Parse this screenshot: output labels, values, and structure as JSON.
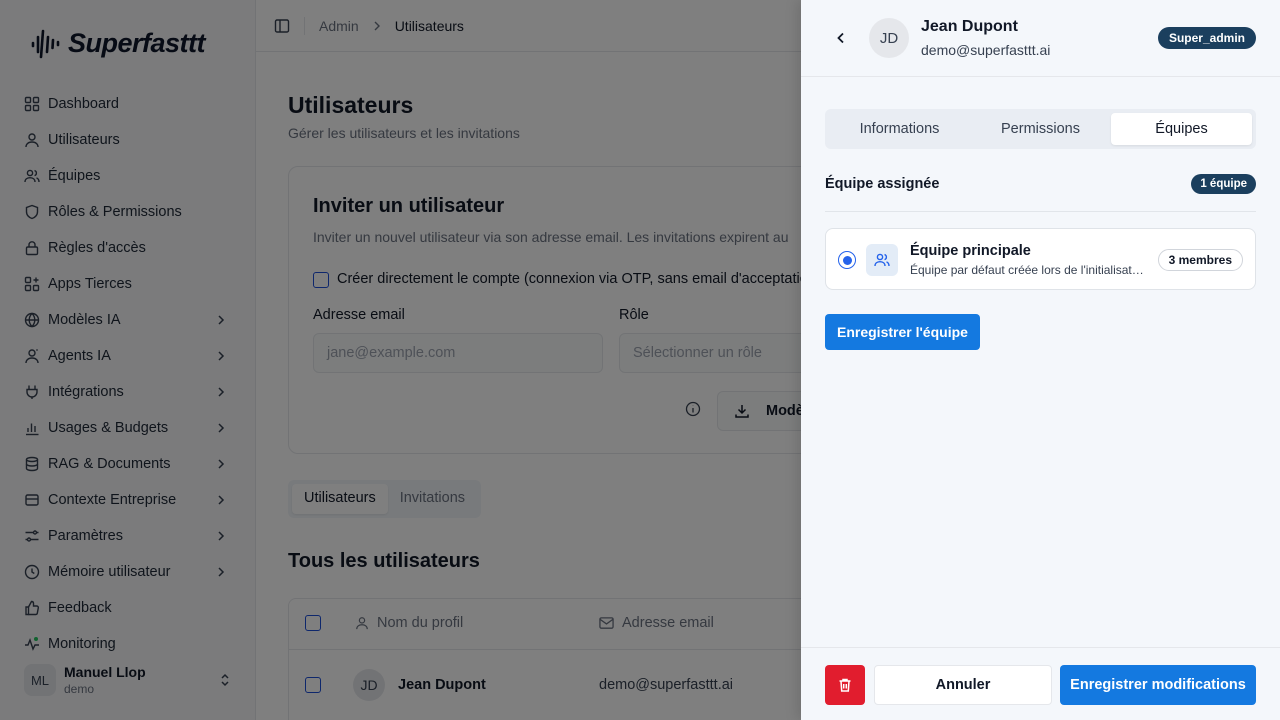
{
  "app": {
    "logo_text": "Superfasttt"
  },
  "sidebar": {
    "items": [
      {
        "label": "Dashboard",
        "icon": "grid-icon",
        "has_chevron": false
      },
      {
        "label": "Utilisateurs",
        "icon": "user-icon",
        "has_chevron": false
      },
      {
        "label": "Équipes",
        "icon": "users-icon",
        "has_chevron": false
      },
      {
        "label": "Rôles & Permissions",
        "icon": "shield-icon",
        "has_chevron": false
      },
      {
        "label": "Règles d'accès",
        "icon": "lock-icon",
        "has_chevron": false
      },
      {
        "label": "Apps Tierces",
        "icon": "apps-icon",
        "has_chevron": false
      },
      {
        "label": "Modèles IA",
        "icon": "globe-icon",
        "has_chevron": true
      },
      {
        "label": "Agents IA",
        "icon": "agent-icon",
        "has_chevron": true
      },
      {
        "label": "Intégrations",
        "icon": "plug-icon",
        "has_chevron": true
      },
      {
        "label": "Usages & Budgets",
        "icon": "bar-chart-icon",
        "has_chevron": true
      },
      {
        "label": "RAG & Documents",
        "icon": "database-icon",
        "has_chevron": true
      },
      {
        "label": "Contexte Entreprise",
        "icon": "building-icon",
        "has_chevron": true
      },
      {
        "label": "Paramètres",
        "icon": "sliders-icon",
        "has_chevron": true
      },
      {
        "label": "Mémoire utilisateur",
        "icon": "memory-icon",
        "has_chevron": true
      },
      {
        "label": "Feedback",
        "icon": "thumbs-up-icon",
        "has_chevron": false
      },
      {
        "label": "Monitoring",
        "icon": "activity-icon",
        "has_chevron": false
      }
    ],
    "user": {
      "initials": "ML",
      "name": "Manuel Llop",
      "org": "demo"
    }
  },
  "header": {
    "breadcrumb": {
      "root": "Admin",
      "current": "Utilisateurs"
    }
  },
  "page": {
    "title": "Utilisateurs",
    "subtitle": "Gérer les utilisateurs et les invitations",
    "invite": {
      "title": "Inviter un utilisateur",
      "description": "Inviter un nouvel utilisateur via son adresse email. Les invitations expirent au",
      "direct_create_label": "Créer directement le compte (connexion via OTP, sans email d'acceptatio",
      "email_label": "Adresse email",
      "email_placeholder": "jane@example.com",
      "role_label": "Rôle",
      "role_placeholder": "Sélectionner un rôle",
      "model_button": "Modè"
    },
    "tabs": [
      "Utilisateurs",
      "Invitations"
    ],
    "all_users_title": "Tous les utilisateurs",
    "table": {
      "headers": [
        "Nom du profil",
        "Adresse email"
      ],
      "rows": [
        {
          "initials": "JD",
          "name": "Jean Dupont",
          "email": "demo@superfasttt.ai"
        }
      ]
    }
  },
  "drawer": {
    "user": {
      "initials": "JD",
      "name": "Jean Dupont",
      "email": "demo@superfasttt.ai",
      "role_badge": "Super_admin"
    },
    "tabs": [
      "Informations",
      "Permissions",
      "Équipes"
    ],
    "active_tab": "Équipes",
    "assigned_label": "Équipe assignée",
    "assigned_count": "1 équipe",
    "team": {
      "name": "Équipe principale",
      "description": "Équipe par défaut créée lors de l'initialisat…",
      "members": "3 membres",
      "selected": true
    },
    "save_team_button": "Enregistrer l'équipe",
    "footer": {
      "cancel": "Annuler",
      "save": "Enregistrer modifications"
    }
  },
  "colors": {
    "primary": "#1479e0",
    "badge": "#1b3f5e",
    "danger": "#e11d2e",
    "overlay": "rgba(0,0,0,0.5)"
  }
}
